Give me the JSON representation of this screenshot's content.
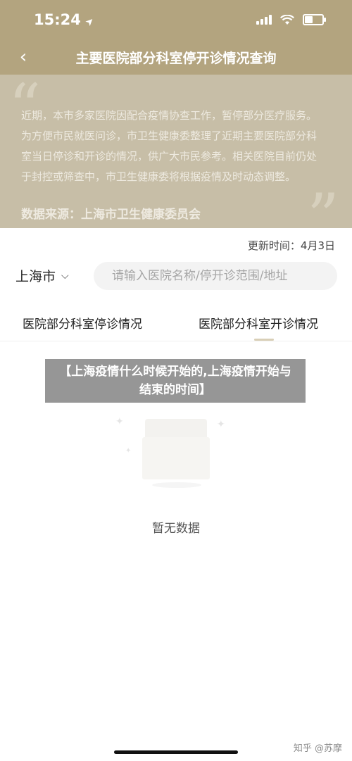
{
  "status_bar": {
    "time": "15:24",
    "location_arrow": "➤"
  },
  "nav": {
    "back": "‹",
    "title": "主要医院部分科室停开诊情况查询"
  },
  "notice": {
    "text": "近期，本市多家医院因配合疫情协查工作，暂停部分医疗服务。为方便市民就医问诊，市卫生健康委整理了近期主要医院部分科室当日停诊和开诊的情况，供广大市民参考。相关医院目前仍处于封控或筛查中，市卫生健康委将根据疫情及时动态调整。",
    "source": "数据来源：上海市卫生健康委员会"
  },
  "update_time": "更新时间：4月3日",
  "filter": {
    "city": "上海市",
    "search_placeholder": "请输入医院名称/停开诊范围/地址"
  },
  "tabs": [
    {
      "label": "医院部分科室停诊情况",
      "active": false
    },
    {
      "label": "医院部分科室开诊情况",
      "active": true
    }
  ],
  "empty": {
    "text": "暂无数据"
  },
  "overlay": {
    "text": "【上海疫情什么时候开始的,上海疫情开始与结束的时间】"
  },
  "watermark": "知乎 @苏摩",
  "colors": {
    "brand": "#b3a47f",
    "notice_bg": "#c7bea7"
  },
  "icons": {
    "signal": "signal-icon",
    "wifi": "wifi-icon",
    "battery": "battery-icon",
    "back": "back-arrow-icon",
    "chevron": "chevron-down-icon",
    "empty": "empty-box-icon"
  },
  "battery_level": 0.45
}
